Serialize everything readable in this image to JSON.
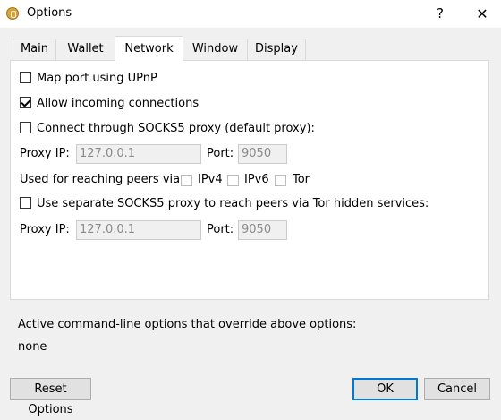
{
  "window": {
    "title": "Options",
    "help": "?",
    "close": "✕"
  },
  "tabs": [
    {
      "label": "Main"
    },
    {
      "label": "Wallet"
    },
    {
      "label": "Network"
    },
    {
      "label": "Window"
    },
    {
      "label": "Display"
    }
  ],
  "network": {
    "map_port_upnp": {
      "label": "Map port using UPnP",
      "checked": false
    },
    "allow_incoming": {
      "label": "Allow incoming connections",
      "checked": true
    },
    "socks5_default": {
      "label": "Connect through SOCKS5 proxy (default proxy):",
      "checked": false
    },
    "proxy_ip_label": "Proxy IP:",
    "proxy_ip_value": "127.0.0.1",
    "port_label": "Port:",
    "port_value": "9050",
    "reach_via_label": "Used for reaching peers via:",
    "ipv4_label": "IPv4",
    "ipv6_label": "IPv6",
    "tor_label": "Tor",
    "socks5_tor": {
      "label": "Use separate SOCKS5 proxy to reach peers via Tor hidden services:",
      "checked": false
    },
    "tor_proxy_ip_label": "Proxy IP:",
    "tor_proxy_ip_value": "127.0.0.1",
    "tor_port_label": "Port:",
    "tor_port_value": "9050"
  },
  "overrides": {
    "label": "Active command-line options that override above options:",
    "value": "none"
  },
  "buttons": {
    "reset": "Reset Options",
    "ok": "OK",
    "cancel": "Cancel"
  },
  "colors": {
    "accent": "#0078d7",
    "panel": "#ffffff",
    "window": "#f0f0f0"
  }
}
